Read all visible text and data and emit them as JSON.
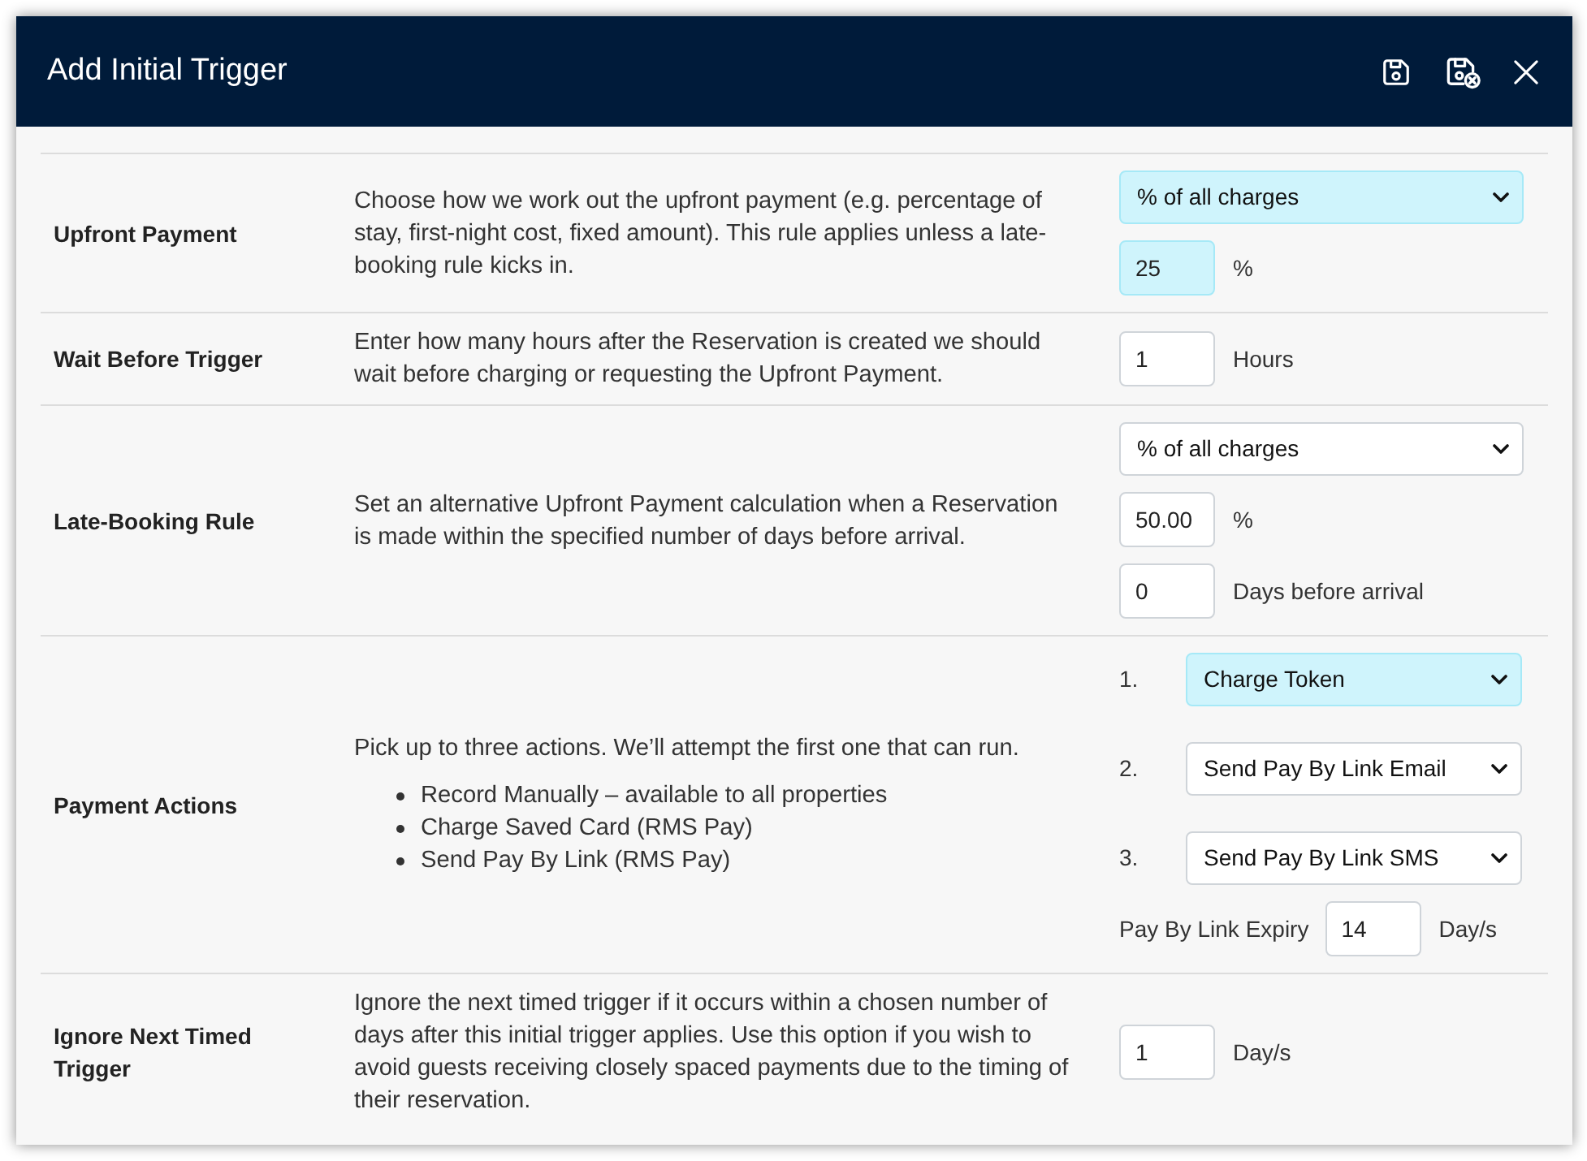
{
  "dialog": {
    "title": "Add Initial Trigger"
  },
  "rows": [
    {
      "label": "Upfront Payment",
      "description": "Choose how we work out the upfront payment (e.g. percentage of stay, first-night cost, fixed amount). This rule applies unless a late-booking rule kicks in.",
      "controls": [
        {
          "kind": "select",
          "value": "% of all charges",
          "highlighted": true
        },
        {
          "kind": "input",
          "value": "25",
          "unit": "%",
          "highlighted": true
        }
      ]
    },
    {
      "label": "Wait Before Trigger",
      "description": "Enter how many hours after the Reservation is created we should wait before charging or requesting the Upfront Payment.",
      "controls": [
        {
          "kind": "input",
          "value": "1",
          "unit": "Hours",
          "highlighted": false
        }
      ]
    },
    {
      "label": "Late-Booking Rule",
      "description": "Set an alternative Upfront Payment calculation when a Reservation is made within the specified number of days before arrival.",
      "controls": [
        {
          "kind": "select",
          "value": "% of all charges",
          "highlighted": false
        },
        {
          "kind": "input",
          "value": "50.00",
          "unit": "%",
          "highlighted": false
        },
        {
          "kind": "input",
          "value": "0",
          "unit": "Days before arrival",
          "highlighted": false
        }
      ]
    },
    {
      "label": "Payment Actions",
      "description": "Pick up to three actions. We’ll attempt the first one that can run.",
      "bullets": [
        "Record Manually – available to all properties",
        "Charge Saved Card (RMS Pay)",
        "Send Pay By Link (RMS Pay)"
      ],
      "controls": [
        {
          "kind": "numbered_select",
          "number": "1.",
          "value": "Charge Token",
          "highlighted": true
        },
        {
          "kind": "numbered_select",
          "number": "2.",
          "value": "Send Pay By Link Email",
          "highlighted": false
        },
        {
          "kind": "numbered_select",
          "number": "3.",
          "value": "Send Pay By Link SMS",
          "highlighted": false
        },
        {
          "kind": "labeled_input",
          "label": "Pay By Link Expiry",
          "value": "14",
          "unit": "Day/s",
          "highlighted": false
        }
      ]
    },
    {
      "label": "Ignore Next Timed Trigger",
      "description": "Ignore the next timed trigger if it occurs within a chosen number of days after this initial trigger applies. Use this option if you wish to avoid guests receiving closely spaced payments due to the timing of their reservation.",
      "controls": [
        {
          "kind": "input",
          "value": "1",
          "unit": "Day/s",
          "highlighted": false
        }
      ]
    }
  ]
}
